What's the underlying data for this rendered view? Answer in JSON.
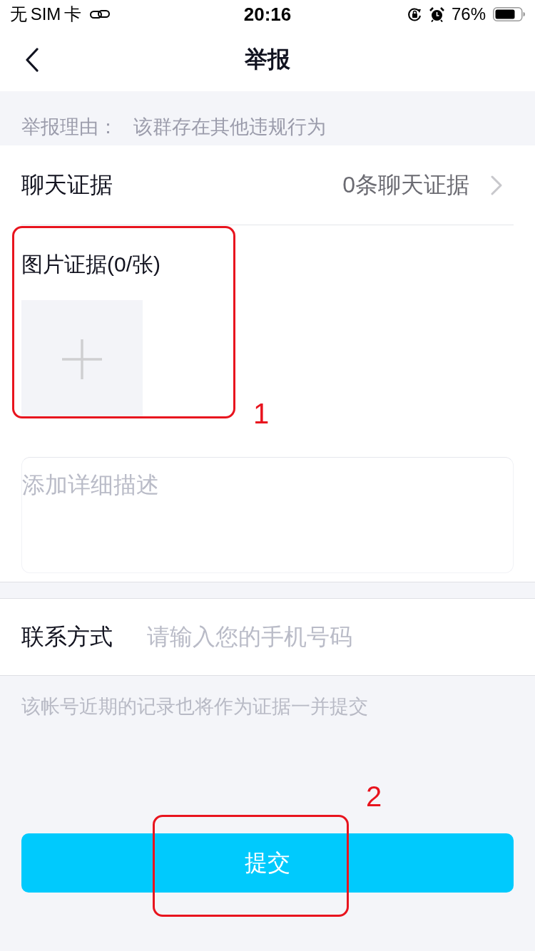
{
  "status_bar": {
    "carrier": "无 SIM 卡",
    "time": "20:16",
    "battery": "76%"
  },
  "nav_bar": {
    "title": "举报"
  },
  "report_reason": {
    "label": "举报理由：",
    "value": "该群存在其他违规行为"
  },
  "chat_evidence": {
    "label": "聊天证据",
    "count": "0条聊天证据"
  },
  "image_evidence": {
    "title": "图片证据(0/张)",
    "annotation": "1"
  },
  "description": {
    "placeholder": "添加详细描述"
  },
  "contact": {
    "label": "联系方式",
    "placeholder": "请输入您的手机号码"
  },
  "note": "该帐号近期的记录也将作为证据一并提交",
  "submit_button": {
    "label": "提交",
    "annotation": "2"
  }
}
